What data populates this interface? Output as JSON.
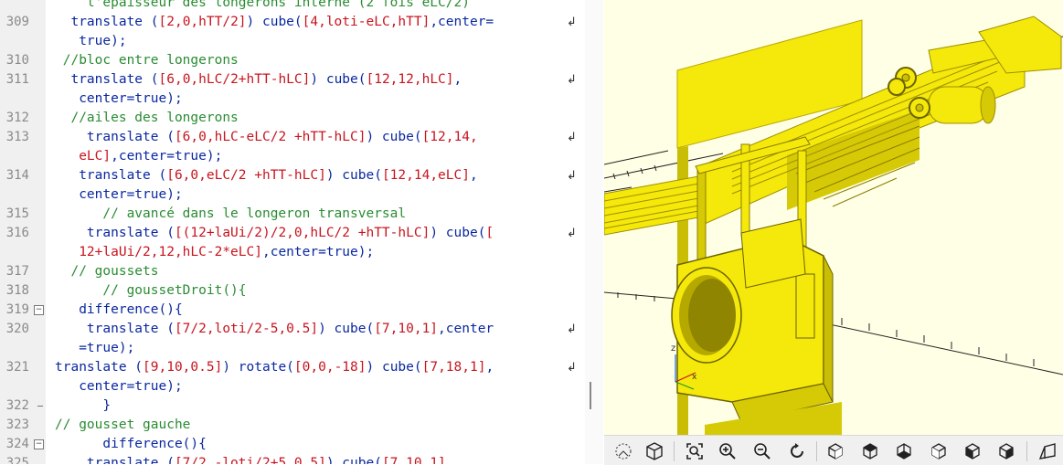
{
  "editor": {
    "lines": [
      {
        "num": "",
        "segs": [
          [
            "c",
            "    l'épaisseur des longerons interne (2 fois eLC/2)"
          ]
        ],
        "wrap": false
      },
      {
        "num": "309",
        "segs": [
          [
            "k",
            "  translate ("
          ],
          [
            "n",
            "[2,0,hTT/2]"
          ],
          [
            "k",
            ") cube("
          ],
          [
            "n",
            "[4,loti-eLC,hTT]"
          ],
          [
            "k",
            ",center="
          ]
        ],
        "wrap": true
      },
      {
        "num": "",
        "segs": [
          [
            "k",
            "   true);"
          ]
        ],
        "wrap": false
      },
      {
        "num": "310",
        "segs": [
          [
            "c",
            " //bloc entre longerons"
          ]
        ],
        "wrap": false
      },
      {
        "num": "311",
        "segs": [
          [
            "k",
            "  translate ("
          ],
          [
            "n",
            "[6,0,hLC/2+hTT-hLC]"
          ],
          [
            "k",
            ") cube("
          ],
          [
            "n",
            "[12,12,hLC]"
          ],
          [
            "k",
            ","
          ]
        ],
        "wrap": true
      },
      {
        "num": "",
        "segs": [
          [
            "k",
            "   center=true);"
          ]
        ],
        "wrap": false
      },
      {
        "num": "312",
        "segs": [
          [
            "c",
            "  //ailes des longerons"
          ]
        ],
        "wrap": false
      },
      {
        "num": "313",
        "segs": [
          [
            "k",
            "    translate ("
          ],
          [
            "n",
            "[6,0,hLC-eLC/2 +hTT-hLC]"
          ],
          [
            "k",
            ") cube("
          ],
          [
            "n",
            "[12,14,"
          ]
        ],
        "wrap": true
      },
      {
        "num": "",
        "segs": [
          [
            "n",
            "   eLC]"
          ],
          [
            "k",
            ",center=true);"
          ]
        ],
        "wrap": false
      },
      {
        "num": "314",
        "segs": [
          [
            "k",
            "   translate ("
          ],
          [
            "n",
            "[6,0,eLC/2 +hTT-hLC]"
          ],
          [
            "k",
            ") cube("
          ],
          [
            "n",
            "[12,14,eLC]"
          ],
          [
            "k",
            ","
          ]
        ],
        "wrap": true
      },
      {
        "num": "",
        "segs": [
          [
            "k",
            "   center=true);"
          ]
        ],
        "wrap": false
      },
      {
        "num": "315",
        "segs": [
          [
            "c",
            "      // avancé dans le longeron transversal"
          ]
        ],
        "wrap": false
      },
      {
        "num": "316",
        "segs": [
          [
            "k",
            "    translate ("
          ],
          [
            "n",
            "[(12+laUi/2)/2,0,hLC/2 +hTT-hLC]"
          ],
          [
            "k",
            ") cube("
          ],
          [
            "n",
            "["
          ]
        ],
        "wrap": true
      },
      {
        "num": "",
        "segs": [
          [
            "n",
            "   12+laUi/2,12,hLC-2*eLC]"
          ],
          [
            "k",
            ",center=true);"
          ]
        ],
        "wrap": false
      },
      {
        "num": "317",
        "segs": [
          [
            "c",
            "  // goussets"
          ]
        ],
        "wrap": false
      },
      {
        "num": "318",
        "segs": [
          [
            "c",
            "      // goussetDroit(){"
          ]
        ],
        "wrap": false
      },
      {
        "num": "319",
        "segs": [
          [
            "k",
            "   difference(){"
          ]
        ],
        "wrap": false,
        "fold": true
      },
      {
        "num": "320",
        "segs": [
          [
            "k",
            "    translate ("
          ],
          [
            "n",
            "[7/2,loti/2-5,0.5]"
          ],
          [
            "k",
            ") cube("
          ],
          [
            "n",
            "[7,10,1]"
          ],
          [
            "k",
            ",center"
          ]
        ],
        "wrap": true
      },
      {
        "num": "",
        "segs": [
          [
            "k",
            "   =true);"
          ]
        ],
        "wrap": false
      },
      {
        "num": "321",
        "segs": [
          [
            "k",
            "translate ("
          ],
          [
            "n",
            "[9,10,0.5]"
          ],
          [
            "k",
            ") rotate("
          ],
          [
            "n",
            "[0,0,-18]"
          ],
          [
            "k",
            ") cube("
          ],
          [
            "n",
            "[7,18,1]"
          ],
          [
            "k",
            ","
          ]
        ],
        "wrap": true
      },
      {
        "num": "",
        "segs": [
          [
            "k",
            "   center=true);"
          ]
        ],
        "wrap": false
      },
      {
        "num": "322",
        "segs": [
          [
            "k",
            "      }"
          ]
        ],
        "wrap": false,
        "tick": true
      },
      {
        "num": "323",
        "segs": [
          [
            "c",
            "// gousset gauche"
          ]
        ],
        "wrap": false
      },
      {
        "num": "324",
        "segs": [
          [
            "k",
            "      difference(){"
          ]
        ],
        "wrap": false,
        "fold": true
      },
      {
        "num": "325",
        "segs": [
          [
            "k",
            "    translate ("
          ],
          [
            "n",
            "[7/2,-loti/2+5,0.5]"
          ],
          [
            "k",
            ") cube("
          ],
          [
            "n",
            "[7,10,1]"
          ]
        ],
        "wrap": false
      }
    ]
  },
  "viewport": {
    "axis_label": "z",
    "model_color": "#f5e80b"
  },
  "toolbar": {
    "icons": [
      "preview-icon",
      "render-icon",
      "view-all-icon",
      "zoom-in-icon",
      "zoom-out-icon",
      "reset-view-icon",
      "view-right-icon",
      "view-top-icon",
      "view-bottom-icon",
      "view-left-icon",
      "view-front-icon",
      "view-back-icon",
      "perspective-icon"
    ]
  }
}
